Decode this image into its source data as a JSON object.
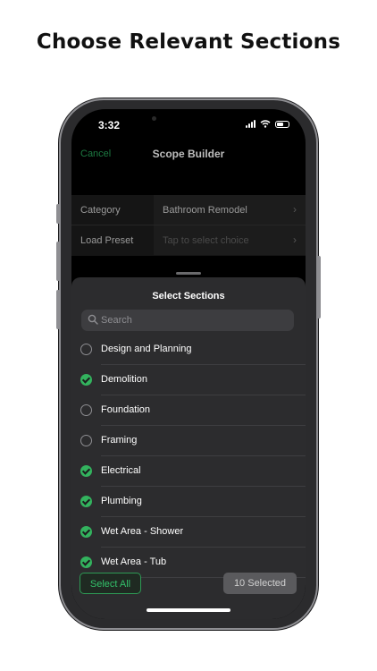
{
  "headline": "Choose Relevant Sections",
  "status": {
    "time": "3:32"
  },
  "nav": {
    "cancel": "Cancel",
    "title": "Scope Builder"
  },
  "form": {
    "category_label": "Category",
    "category_value": "Bathroom Remodel",
    "preset_label": "Load Preset",
    "preset_placeholder": "Tap to select choice",
    "chevron": "›"
  },
  "sheet": {
    "title": "Select Sections",
    "search_placeholder": "Search",
    "items": [
      {
        "label": "Design and Planning",
        "selected": false
      },
      {
        "label": "Demolition",
        "selected": true
      },
      {
        "label": "Foundation",
        "selected": false
      },
      {
        "label": "Framing",
        "selected": false
      },
      {
        "label": "Electrical",
        "selected": true
      },
      {
        "label": "Plumbing",
        "selected": true
      },
      {
        "label": "Wet Area - Shower",
        "selected": true
      },
      {
        "label": "Wet Area - Tub",
        "selected": true
      }
    ],
    "select_all": "Select All",
    "selected_count": "10 Selected"
  },
  "colors": {
    "accent": "#33b35e",
    "background": "#ffffff",
    "sheet": "#2c2c2e"
  }
}
